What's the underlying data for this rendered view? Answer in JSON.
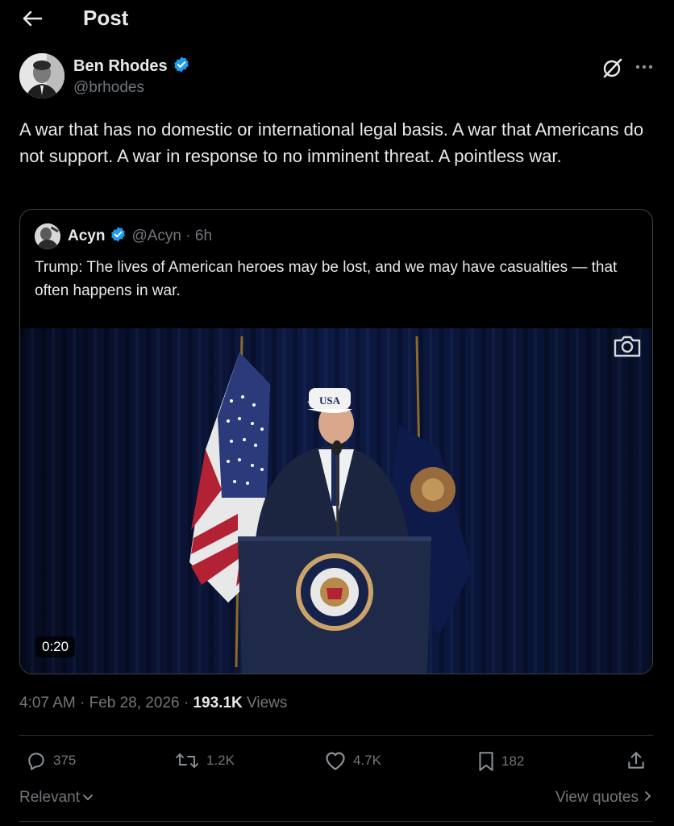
{
  "header": {
    "title": "Post"
  },
  "post": {
    "author_name": "Ben Rhodes",
    "author_handle": "@brhodes",
    "text": "A war that has no domestic or international legal basis. A war that Americans do not support. A war in response to no imminent threat. A pointless war.",
    "timestamp": "4:07 AM · Feb 28, 2026 · ",
    "views_count": "193.1K",
    "views_label": " Views"
  },
  "quote": {
    "author_name": "Acyn",
    "author_handle": "@Acyn",
    "age": " · 6h",
    "text": "Trump: The lives of American heroes may be lost, and we may have casualties — that often happens in war.",
    "video_duration": "0:20"
  },
  "actions": {
    "replies": "375",
    "reposts": "1.2K",
    "likes": "4.7K",
    "bookmarks": "182"
  },
  "footer": {
    "sort_label": "Relevant",
    "view_quotes_label": "View quotes"
  },
  "colors": {
    "background": "#000000",
    "text": "#e7e9ea",
    "secondary": "#71767b",
    "verified": "#1d9bf0",
    "border": "#2f3336"
  }
}
